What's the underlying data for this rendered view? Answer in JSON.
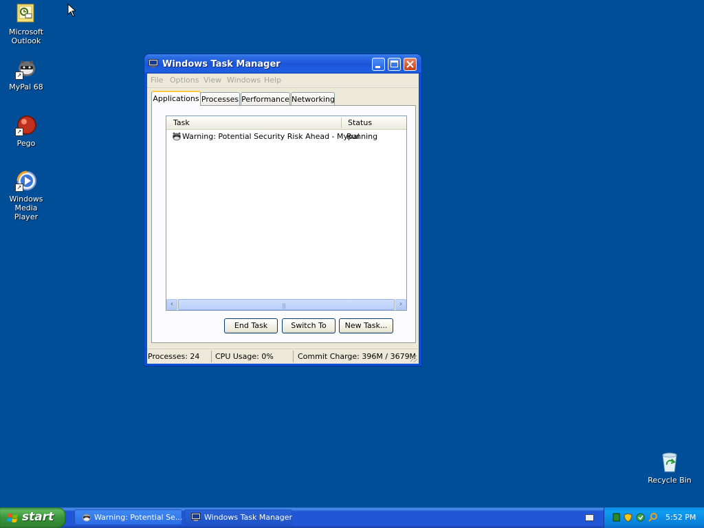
{
  "desktop": {
    "icons": [
      {
        "label_line1": "Microsoft",
        "label_line2": "Outlook",
        "icon": "outlook-icon"
      },
      {
        "label_line1": "MyPal 68",
        "label_line2": "",
        "icon": "mypal-raccoon-icon"
      },
      {
        "label_line1": "Pego",
        "label_line2": "",
        "icon": "pego-icon"
      },
      {
        "label_line1": "Windows Media",
        "label_line2": "Player",
        "icon": "windows-media-player-icon"
      },
      {
        "label_line1": "Recycle Bin",
        "label_line2": "",
        "icon": "recycle-bin-icon"
      }
    ]
  },
  "window": {
    "title": "Windows Task Manager",
    "menu": [
      "File",
      "Options",
      "View",
      "Windows",
      "Help"
    ],
    "tabs": [
      "Applications",
      "Processes",
      "Performance",
      "Networking"
    ],
    "active_tab": "Applications",
    "list": {
      "columns": [
        "Task",
        "Status"
      ],
      "rows": [
        {
          "task": "Warning: Potential Security Risk Ahead - Mypal",
          "status": "Running"
        }
      ]
    },
    "buttons": {
      "end_task": "End Task",
      "switch_to": "Switch To",
      "new_task": "New Task..."
    },
    "status": {
      "processes": "Processes: 24",
      "cpu": "CPU Usage: 0%",
      "commit": "Commit Charge: 396M / 3679M"
    }
  },
  "taskbar": {
    "start_label": "start",
    "tasks": [
      {
        "label": "Warning: Potential Se...",
        "icon": "mypal-raccoon-icon"
      },
      {
        "label": "Windows Task Manager",
        "icon": "task-manager-icon"
      }
    ],
    "clock": "5:52 PM"
  },
  "colors": {
    "desktop": "#004e98",
    "titlebar": "#1b56d8",
    "taskbar": "#2157d7",
    "start": "#3a953a",
    "tray": "#0f9cf0"
  }
}
